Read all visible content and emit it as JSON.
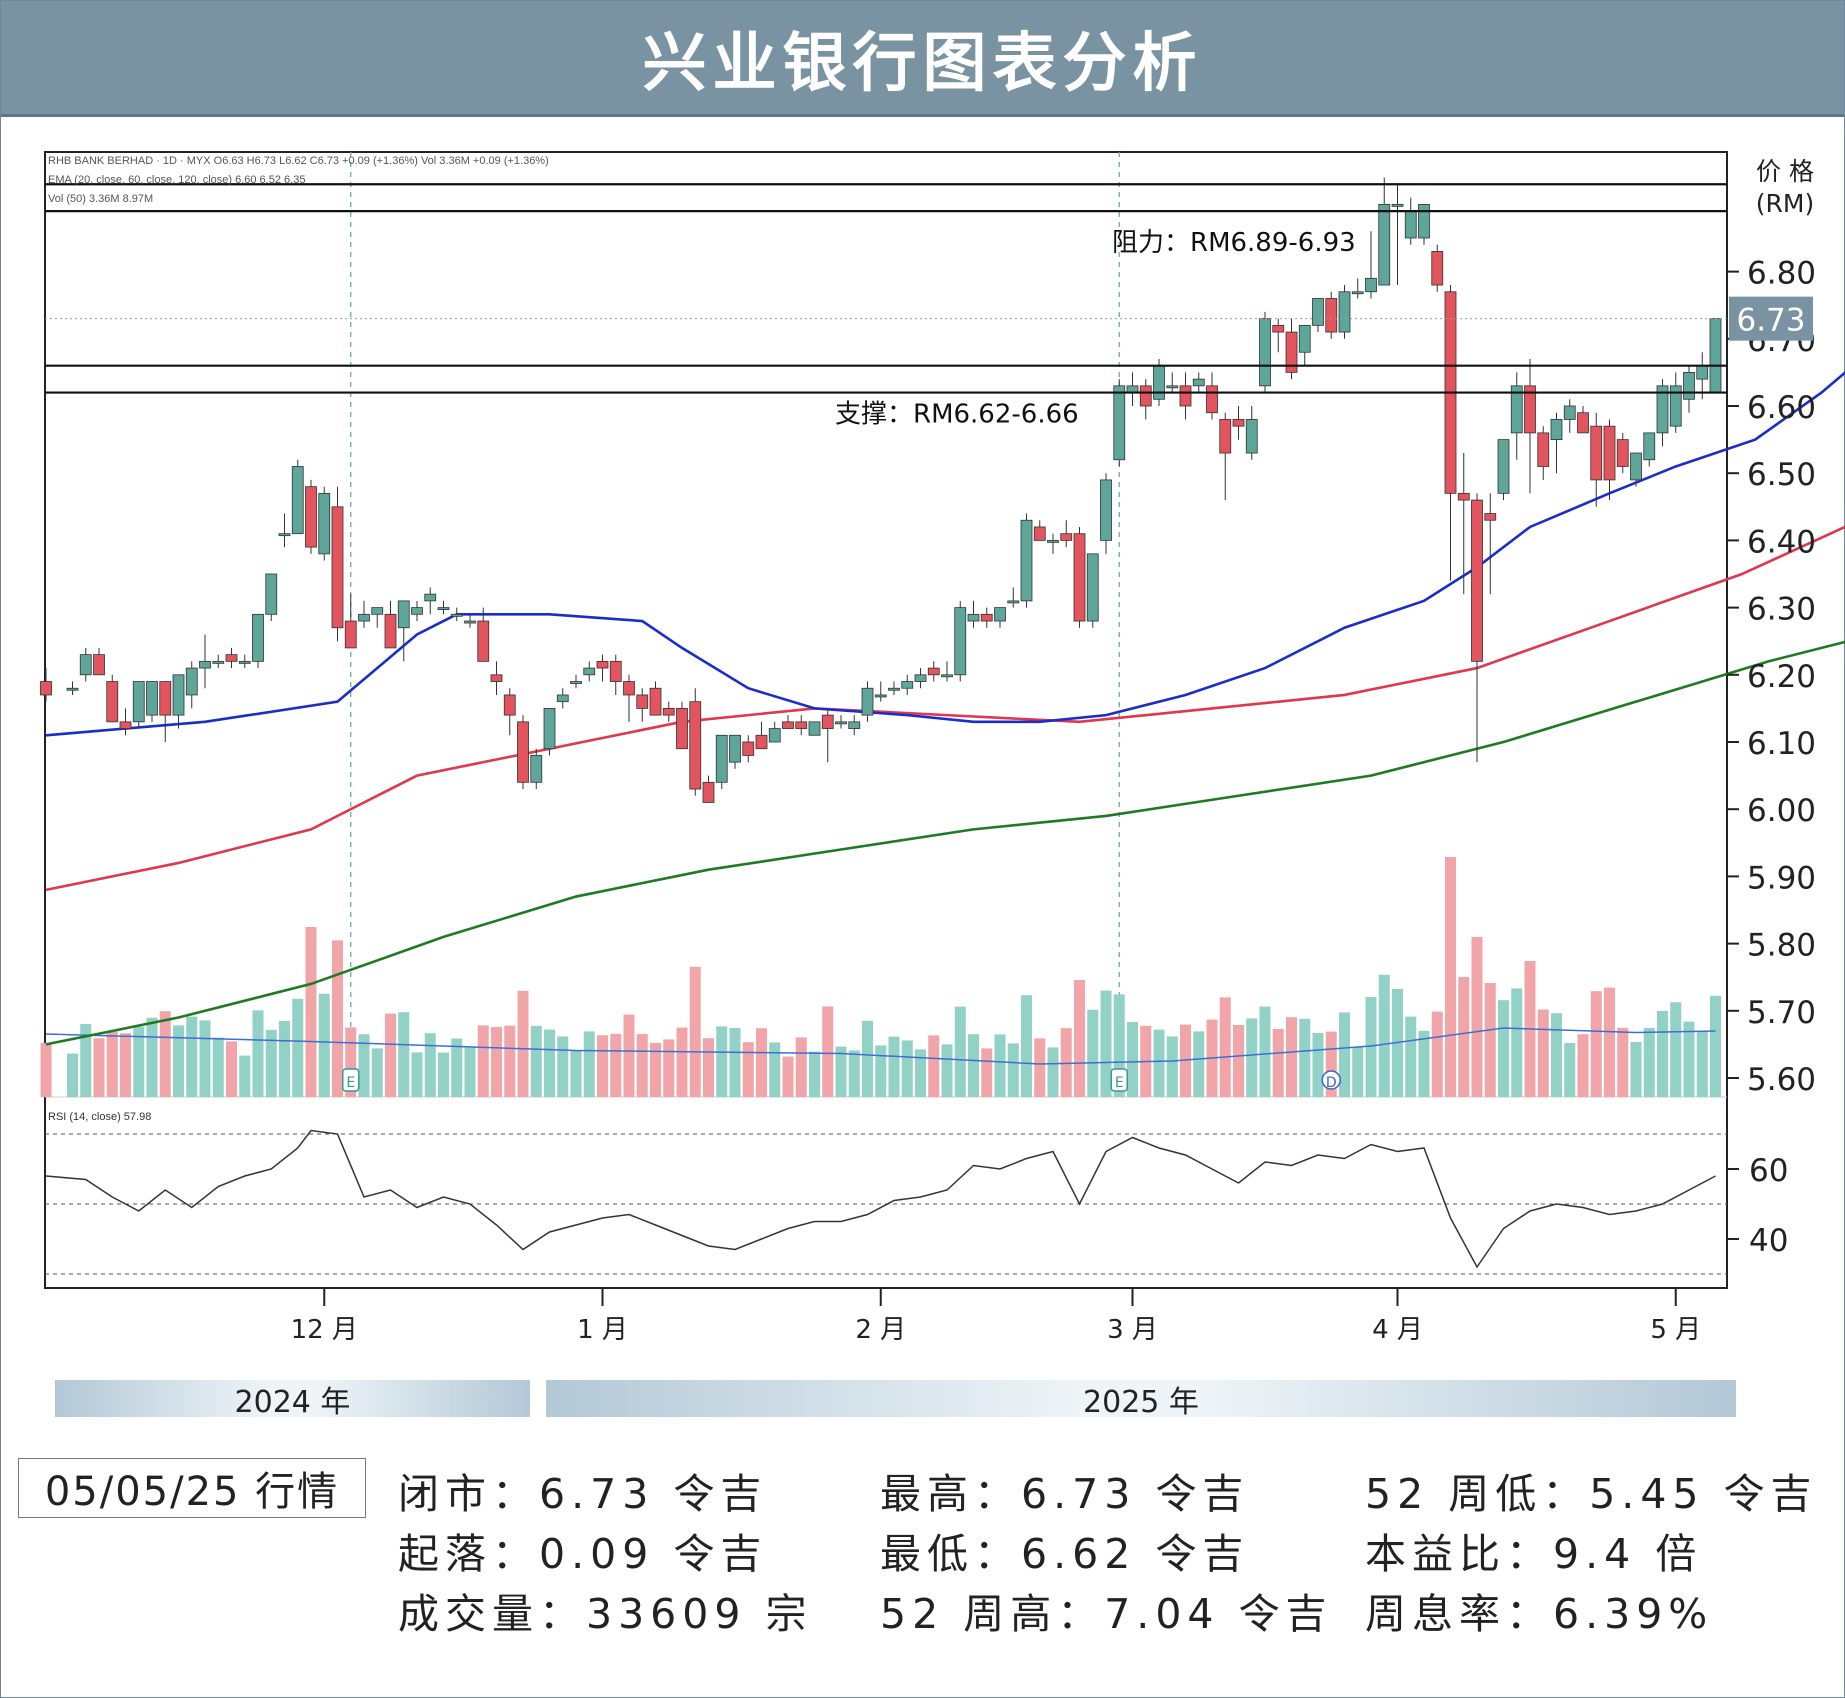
{
  "header": {
    "title": "兴业银行图表分析"
  },
  "chart_data": {
    "type": "candlestick",
    "legend_lines": [
      "RHB BANK BERHAD · 1D · MYX  O6.63  H6.73  L6.62  C6.73  +0.09 (+1.36%)  Vol 3.36M  +0.09 (+1.36%)",
      "EMA (20, close, 60, close, 120, close)  6.60  6.52  6.35",
      "Vol (50)  3.36M  8.97M"
    ],
    "y_axis_label": "价 格",
    "y_axis_unit": "(RM)",
    "price_ticks": [
      "6.80",
      "6.70",
      "6.60",
      "6.50",
      "6.40",
      "6.30",
      "6.20",
      "6.10",
      "6.00",
      "5.90",
      "5.80",
      "5.70",
      "5.60"
    ],
    "price_range": [
      5.575,
      6.94
    ],
    "last_price": "6.73",
    "resistance": {
      "label": "阻力：RM6.89-6.93",
      "low": 6.89,
      "high": 6.93
    },
    "support": {
      "label": "支撑：RM6.62-6.66",
      "low": 6.62,
      "high": 6.66
    },
    "ema_colors": {
      "ema20": "#1a2ccc",
      "ema60": "#e0364f",
      "ema120": "#1f7a22"
    },
    "ema20": [
      [
        0,
        6.11
      ],
      [
        12,
        6.13
      ],
      [
        22,
        6.16
      ],
      [
        28,
        6.26
      ],
      [
        31,
        6.29
      ],
      [
        38,
        6.29
      ],
      [
        45,
        6.28
      ],
      [
        48,
        6.24
      ],
      [
        53,
        6.18
      ],
      [
        58,
        6.15
      ],
      [
        65,
        6.14
      ],
      [
        70,
        6.13
      ],
      [
        75,
        6.13
      ],
      [
        80,
        6.14
      ],
      [
        86,
        6.17
      ],
      [
        92,
        6.21
      ],
      [
        98,
        6.27
      ],
      [
        104,
        6.31
      ],
      [
        108,
        6.36
      ],
      [
        112,
        6.42
      ],
      [
        118,
        6.47
      ],
      [
        123,
        6.51
      ],
      [
        129,
        6.55
      ],
      [
        134,
        6.62
      ],
      [
        137,
        6.67
      ],
      [
        140,
        6.69
      ],
      [
        145,
        6.66
      ],
      [
        149,
        6.63
      ],
      [
        153,
        6.62
      ],
      [
        158,
        6.61
      ],
      [
        165,
        6.59
      ],
      [
        170,
        6.6
      ]
    ],
    "ema60": [
      [
        0,
        5.88
      ],
      [
        10,
        5.92
      ],
      [
        20,
        5.97
      ],
      [
        28,
        6.05
      ],
      [
        38,
        6.09
      ],
      [
        48,
        6.13
      ],
      [
        58,
        6.15
      ],
      [
        68,
        6.14
      ],
      [
        78,
        6.13
      ],
      [
        88,
        6.15
      ],
      [
        98,
        6.17
      ],
      [
        108,
        6.21
      ],
      [
        118,
        6.28
      ],
      [
        128,
        6.35
      ],
      [
        138,
        6.44
      ],
      [
        145,
        6.48
      ],
      [
        155,
        6.5
      ],
      [
        162,
        6.5
      ],
      [
        170,
        6.52
      ]
    ],
    "ema120": [
      [
        0,
        5.65
      ],
      [
        10,
        5.69
      ],
      [
        20,
        5.74
      ],
      [
        30,
        5.81
      ],
      [
        40,
        5.87
      ],
      [
        50,
        5.91
      ],
      [
        60,
        5.94
      ],
      [
        70,
        5.97
      ],
      [
        80,
        5.99
      ],
      [
        90,
        6.02
      ],
      [
        100,
        6.05
      ],
      [
        110,
        6.1
      ],
      [
        120,
        6.16
      ],
      [
        130,
        6.22
      ],
      [
        140,
        6.27
      ],
      [
        145,
        6.28
      ],
      [
        155,
        6.31
      ],
      [
        165,
        6.33
      ],
      [
        170,
        6.35
      ]
    ],
    "candles": [
      [
        0,
        6.19,
        6.21,
        6.16,
        6.17
      ],
      [
        2,
        6.18,
        6.19,
        6.17,
        6.18
      ],
      [
        3,
        6.2,
        6.24,
        6.19,
        6.23
      ],
      [
        4,
        6.23,
        6.24,
        6.2,
        6.2
      ],
      [
        5,
        6.19,
        6.2,
        6.13,
        6.13
      ],
      [
        6,
        6.13,
        6.15,
        6.11,
        6.12
      ],
      [
        7,
        6.13,
        6.19,
        6.12,
        6.19
      ],
      [
        8,
        6.14,
        6.19,
        6.13,
        6.19
      ],
      [
        9,
        6.19,
        6.19,
        6.1,
        6.14
      ],
      [
        10,
        6.14,
        6.2,
        6.12,
        6.2
      ],
      [
        11,
        6.17,
        6.22,
        6.15,
        6.21
      ],
      [
        12,
        6.21,
        6.26,
        6.18,
        6.22
      ],
      [
        13,
        6.22,
        6.23,
        6.21,
        6.22
      ],
      [
        14,
        6.23,
        6.24,
        6.21,
        6.22
      ],
      [
        15,
        6.22,
        6.23,
        6.21,
        6.22
      ],
      [
        16,
        6.22,
        6.29,
        6.21,
        6.29
      ],
      [
        17,
        6.29,
        6.34,
        6.28,
        6.35
      ],
      [
        18,
        6.41,
        6.44,
        6.39,
        6.41
      ],
      [
        19,
        6.41,
        6.52,
        6.41,
        6.51
      ],
      [
        20,
        6.48,
        6.49,
        6.38,
        6.39
      ],
      [
        21,
        6.38,
        6.48,
        6.37,
        6.47
      ],
      [
        22,
        6.45,
        6.48,
        6.25,
        6.27
      ],
      [
        23,
        6.28,
        6.32,
        6.24,
        6.24
      ],
      [
        24,
        6.28,
        6.31,
        6.27,
        6.29
      ],
      [
        25,
        6.29,
        6.3,
        6.27,
        6.3
      ],
      [
        26,
        6.29,
        6.31,
        6.24,
        6.24
      ],
      [
        27,
        6.27,
        6.31,
        6.22,
        6.31
      ],
      [
        28,
        6.29,
        6.31,
        6.28,
        6.3
      ],
      [
        29,
        6.31,
        6.33,
        6.29,
        6.32
      ],
      [
        30,
        6.3,
        6.31,
        6.29,
        6.3
      ],
      [
        31,
        6.29,
        6.3,
        6.28,
        6.29
      ],
      [
        32,
        6.28,
        6.29,
        6.27,
        6.28
      ],
      [
        33,
        6.28,
        6.3,
        6.22,
        6.22
      ],
      [
        34,
        6.2,
        6.22,
        6.17,
        6.19
      ],
      [
        35,
        6.17,
        6.18,
        6.11,
        6.14
      ],
      [
        36,
        6.13,
        6.14,
        6.03,
        6.04
      ],
      [
        37,
        6.04,
        6.09,
        6.03,
        6.08
      ],
      [
        38,
        6.09,
        6.15,
        6.08,
        6.15
      ],
      [
        39,
        6.16,
        6.18,
        6.15,
        6.17
      ],
      [
        40,
        6.19,
        6.2,
        6.18,
        6.19
      ],
      [
        41,
        6.2,
        6.22,
        6.19,
        6.21
      ],
      [
        42,
        6.22,
        6.23,
        6.19,
        6.21
      ],
      [
        43,
        6.22,
        6.23,
        6.17,
        6.19
      ],
      [
        44,
        6.19,
        6.2,
        6.13,
        6.17
      ],
      [
        45,
        6.17,
        6.18,
        6.13,
        6.15
      ],
      [
        46,
        6.18,
        6.19,
        6.14,
        6.14
      ],
      [
        47,
        6.15,
        6.16,
        6.13,
        6.14
      ],
      [
        48,
        6.15,
        6.16,
        6.09,
        6.09
      ],
      [
        49,
        6.16,
        6.18,
        6.02,
        6.03
      ],
      [
        50,
        6.04,
        6.05,
        6.01,
        6.01
      ],
      [
        51,
        6.04,
        6.11,
        6.03,
        6.11
      ],
      [
        52,
        6.07,
        6.11,
        6.06,
        6.11
      ],
      [
        53,
        6.1,
        6.11,
        6.07,
        6.08
      ],
      [
        54,
        6.11,
        6.13,
        6.09,
        6.09
      ],
      [
        55,
        6.1,
        6.13,
        6.1,
        6.12
      ],
      [
        56,
        6.13,
        6.14,
        6.12,
        6.12
      ],
      [
        57,
        6.13,
        6.14,
        6.11,
        6.12
      ],
      [
        58,
        6.11,
        6.13,
        6.11,
        6.13
      ],
      [
        59,
        6.14,
        6.15,
        6.07,
        6.12
      ],
      [
        60,
        6.13,
        6.14,
        6.12,
        6.13
      ],
      [
        61,
        6.12,
        6.14,
        6.11,
        6.13
      ],
      [
        62,
        6.14,
        6.19,
        6.13,
        6.18
      ],
      [
        63,
        6.17,
        6.19,
        6.16,
        6.17
      ],
      [
        64,
        6.18,
        6.19,
        6.17,
        6.18
      ],
      [
        65,
        6.18,
        6.2,
        6.17,
        6.19
      ],
      [
        66,
        6.19,
        6.21,
        6.18,
        6.2
      ],
      [
        67,
        6.21,
        6.22,
        6.19,
        6.2
      ],
      [
        68,
        6.2,
        6.22,
        6.19,
        6.2
      ],
      [
        69,
        6.2,
        6.31,
        6.19,
        6.3
      ],
      [
        70,
        6.28,
        6.31,
        6.27,
        6.29
      ],
      [
        71,
        6.29,
        6.3,
        6.27,
        6.28
      ],
      [
        72,
        6.28,
        6.3,
        6.27,
        6.3
      ],
      [
        73,
        6.31,
        6.33,
        6.3,
        6.31
      ],
      [
        74,
        6.31,
        6.44,
        6.3,
        6.43
      ],
      [
        75,
        6.42,
        6.43,
        6.4,
        6.4
      ],
      [
        76,
        6.4,
        6.41,
        6.38,
        6.4
      ],
      [
        77,
        6.41,
        6.43,
        6.39,
        6.4
      ],
      [
        78,
        6.41,
        6.42,
        6.27,
        6.28
      ],
      [
        79,
        6.28,
        6.38,
        6.27,
        6.38
      ],
      [
        80,
        6.4,
        6.5,
        6.38,
        6.49
      ],
      [
        81,
        6.52,
        6.64,
        6.51,
        6.63
      ],
      [
        82,
        6.62,
        6.65,
        6.6,
        6.63
      ],
      [
        83,
        6.63,
        6.64,
        6.58,
        6.6
      ],
      [
        84,
        6.61,
        6.67,
        6.6,
        6.66
      ],
      [
        85,
        6.63,
        6.65,
        6.62,
        6.63
      ],
      [
        86,
        6.63,
        6.65,
        6.58,
        6.6
      ],
      [
        87,
        6.63,
        6.65,
        6.62,
        6.64
      ],
      [
        88,
        6.63,
        6.65,
        6.58,
        6.59
      ],
      [
        89,
        6.58,
        6.59,
        6.46,
        6.53
      ],
      [
        90,
        6.58,
        6.6,
        6.55,
        6.57
      ],
      [
        91,
        6.53,
        6.6,
        6.52,
        6.58
      ],
      [
        92,
        6.63,
        6.74,
        6.62,
        6.73
      ],
      [
        93,
        6.72,
        6.73,
        6.68,
        6.71
      ],
      [
        94,
        6.71,
        6.73,
        6.64,
        6.65
      ],
      [
        95,
        6.68,
        6.72,
        6.66,
        6.72
      ],
      [
        96,
        6.72,
        6.76,
        6.71,
        6.76
      ],
      [
        97,
        6.76,
        6.77,
        6.7,
        6.71
      ],
      [
        98,
        6.71,
        6.78,
        6.7,
        6.77
      ],
      [
        99,
        6.77,
        6.79,
        6.76,
        6.77
      ],
      [
        100,
        6.77,
        6.86,
        6.76,
        6.79
      ],
      [
        101,
        6.78,
        6.94,
        6.78,
        6.9
      ],
      [
        102,
        6.9,
        6.93,
        6.78,
        6.9
      ],
      [
        103,
        6.85,
        6.91,
        6.84,
        6.89
      ],
      [
        104,
        6.85,
        6.9,
        6.84,
        6.9
      ],
      [
        105,
        6.83,
        6.84,
        6.77,
        6.78
      ],
      [
        106,
        6.77,
        6.78,
        6.34,
        6.47
      ],
      [
        107,
        6.47,
        6.53,
        6.32,
        6.46
      ],
      [
        108,
        6.46,
        6.47,
        6.07,
        6.22
      ],
      [
        109,
        6.44,
        6.47,
        6.32,
        6.43
      ],
      [
        110,
        6.47,
        6.55,
        6.46,
        6.55
      ],
      [
        111,
        6.56,
        6.65,
        6.52,
        6.63
      ],
      [
        112,
        6.63,
        6.67,
        6.47,
        6.56
      ],
      [
        113,
        6.56,
        6.57,
        6.49,
        6.51
      ],
      [
        114,
        6.55,
        6.59,
        6.5,
        6.58
      ],
      [
        115,
        6.58,
        6.61,
        6.56,
        6.6
      ],
      [
        116,
        6.59,
        6.6,
        6.56,
        6.56
      ],
      [
        117,
        6.57,
        6.59,
        6.45,
        6.49
      ],
      [
        118,
        6.57,
        6.58,
        6.46,
        6.49
      ],
      [
        119,
        6.55,
        6.56,
        6.5,
        6.51
      ],
      [
        120,
        6.49,
        6.53,
        6.48,
        6.53
      ],
      [
        121,
        6.52,
        6.56,
        6.51,
        6.56
      ],
      [
        122,
        6.56,
        6.64,
        6.54,
        6.63
      ],
      [
        123,
        6.57,
        6.65,
        6.56,
        6.63
      ],
      [
        124,
        6.61,
        6.66,
        6.59,
        6.65
      ],
      [
        125,
        6.64,
        6.68,
        6.61,
        6.66
      ],
      [
        126,
        6.62,
        6.73,
        6.62,
        6.73
      ]
    ],
    "volume_ma": [
      [
        0,
        0.42
      ],
      [
        20,
        0.37
      ],
      [
        40,
        0.31
      ],
      [
        60,
        0.29
      ],
      [
        75,
        0.22
      ],
      [
        85,
        0.24
      ],
      [
        100,
        0.34
      ],
      [
        110,
        0.46
      ],
      [
        120,
        0.43
      ],
      [
        126,
        0.44
      ]
    ],
    "events": [
      {
        "i": 23,
        "label": "E"
      },
      {
        "i": 81,
        "label": "E"
      },
      {
        "i": 97,
        "label": "D"
      }
    ],
    "rsi": {
      "label": "RSI (14, close)",
      "value": "57.98",
      "ticks": [
        "60",
        "40"
      ],
      "range": [
        22,
        78
      ],
      "levels": [
        70,
        50,
        30
      ],
      "points": [
        [
          0,
          58
        ],
        [
          3,
          57
        ],
        [
          5,
          52
        ],
        [
          7,
          48
        ],
        [
          9,
          54
        ],
        [
          11,
          49
        ],
        [
          13,
          55
        ],
        [
          15,
          58
        ],
        [
          17,
          60
        ],
        [
          19,
          66
        ],
        [
          20,
          71
        ],
        [
          22,
          70
        ],
        [
          24,
          52
        ],
        [
          26,
          54
        ],
        [
          28,
          49
        ],
        [
          30,
          52
        ],
        [
          32,
          50
        ],
        [
          34,
          44
        ],
        [
          36,
          37
        ],
        [
          38,
          42
        ],
        [
          40,
          44
        ],
        [
          42,
          46
        ],
        [
          44,
          47
        ],
        [
          46,
          44
        ],
        [
          48,
          41
        ],
        [
          50,
          38
        ],
        [
          52,
          37
        ],
        [
          54,
          40
        ],
        [
          56,
          43
        ],
        [
          58,
          45
        ],
        [
          60,
          45
        ],
        [
          62,
          47
        ],
        [
          64,
          51
        ],
        [
          66,
          52
        ],
        [
          68,
          54
        ],
        [
          70,
          61
        ],
        [
          72,
          60
        ],
        [
          74,
          63
        ],
        [
          76,
          65
        ],
        [
          78,
          50
        ],
        [
          80,
          65
        ],
        [
          82,
          69
        ],
        [
          84,
          66
        ],
        [
          86,
          64
        ],
        [
          88,
          60
        ],
        [
          90,
          56
        ],
        [
          92,
          62
        ],
        [
          94,
          61
        ],
        [
          96,
          64
        ],
        [
          98,
          63
        ],
        [
          100,
          67
        ],
        [
          102,
          65
        ],
        [
          104,
          66
        ],
        [
          106,
          46
        ],
        [
          108,
          32
        ],
        [
          110,
          43
        ],
        [
          112,
          48
        ],
        [
          114,
          50
        ],
        [
          116,
          49
        ],
        [
          118,
          47
        ],
        [
          120,
          48
        ],
        [
          122,
          50
        ],
        [
          124,
          54
        ],
        [
          126,
          58
        ]
      ]
    },
    "x_ticks": [
      {
        "i": 21,
        "label": "12 月"
      },
      {
        "i": 42,
        "label": "1 月"
      },
      {
        "i": 63,
        "label": "2 月"
      },
      {
        "i": 82,
        "label": "3 月"
      },
      {
        "i": 102,
        "label": "4 月"
      },
      {
        "i": 123,
        "label": "5 月"
      }
    ],
    "years": [
      "2024 年",
      "2025 年"
    ]
  },
  "stats": {
    "date": "05/05/25 行情",
    "close": "闭市：6.73 令吉",
    "change": "起落：0.09 令吉",
    "volume": "成交量：33609 宗",
    "high": "最高：6.73 令吉",
    "low": "最低：6.62 令吉",
    "high52": "52 周高：7.04 令吉",
    "low52": "52 周低：5.45 令吉",
    "pe": "本益比：9.4 倍",
    "yield": "周息率：6.39%"
  }
}
